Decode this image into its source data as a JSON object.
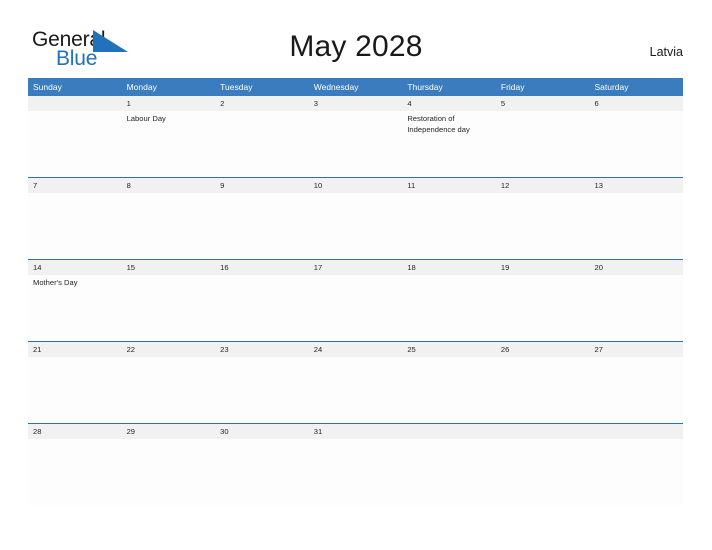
{
  "brand": {
    "name_part1": "General",
    "name_part2": "Blue",
    "flag_icon": "blue-triangle-flag-icon",
    "accent_color": "#2272bb"
  },
  "header": {
    "title": "May 2028",
    "region": "Latvia"
  },
  "theme": {
    "header_blue": "#3a7cbe",
    "separator_blue": "#2f6fad",
    "date_strip_gray": "#f1f1f1",
    "text_color": "#262626"
  },
  "calendar": {
    "weekdays": [
      "Sunday",
      "Monday",
      "Tuesday",
      "Wednesday",
      "Thursday",
      "Friday",
      "Saturday"
    ],
    "weeks": [
      {
        "days": [
          {
            "date": "",
            "event": ""
          },
          {
            "date": "1",
            "event": "Labour Day"
          },
          {
            "date": "2",
            "event": ""
          },
          {
            "date": "3",
            "event": ""
          },
          {
            "date": "4",
            "event": "Restoration of Independence day"
          },
          {
            "date": "5",
            "event": ""
          },
          {
            "date": "6",
            "event": ""
          }
        ]
      },
      {
        "days": [
          {
            "date": "7",
            "event": ""
          },
          {
            "date": "8",
            "event": ""
          },
          {
            "date": "9",
            "event": ""
          },
          {
            "date": "10",
            "event": ""
          },
          {
            "date": "11",
            "event": ""
          },
          {
            "date": "12",
            "event": ""
          },
          {
            "date": "13",
            "event": ""
          }
        ]
      },
      {
        "days": [
          {
            "date": "14",
            "event": "Mother's Day"
          },
          {
            "date": "15",
            "event": ""
          },
          {
            "date": "16",
            "event": ""
          },
          {
            "date": "17",
            "event": ""
          },
          {
            "date": "18",
            "event": ""
          },
          {
            "date": "19",
            "event": ""
          },
          {
            "date": "20",
            "event": ""
          }
        ]
      },
      {
        "days": [
          {
            "date": "21",
            "event": ""
          },
          {
            "date": "22",
            "event": ""
          },
          {
            "date": "23",
            "event": ""
          },
          {
            "date": "24",
            "event": ""
          },
          {
            "date": "25",
            "event": ""
          },
          {
            "date": "26",
            "event": ""
          },
          {
            "date": "27",
            "event": ""
          }
        ]
      },
      {
        "days": [
          {
            "date": "28",
            "event": ""
          },
          {
            "date": "29",
            "event": ""
          },
          {
            "date": "30",
            "event": ""
          },
          {
            "date": "31",
            "event": ""
          },
          {
            "date": "",
            "event": ""
          },
          {
            "date": "",
            "event": ""
          },
          {
            "date": "",
            "event": ""
          }
        ]
      }
    ]
  }
}
